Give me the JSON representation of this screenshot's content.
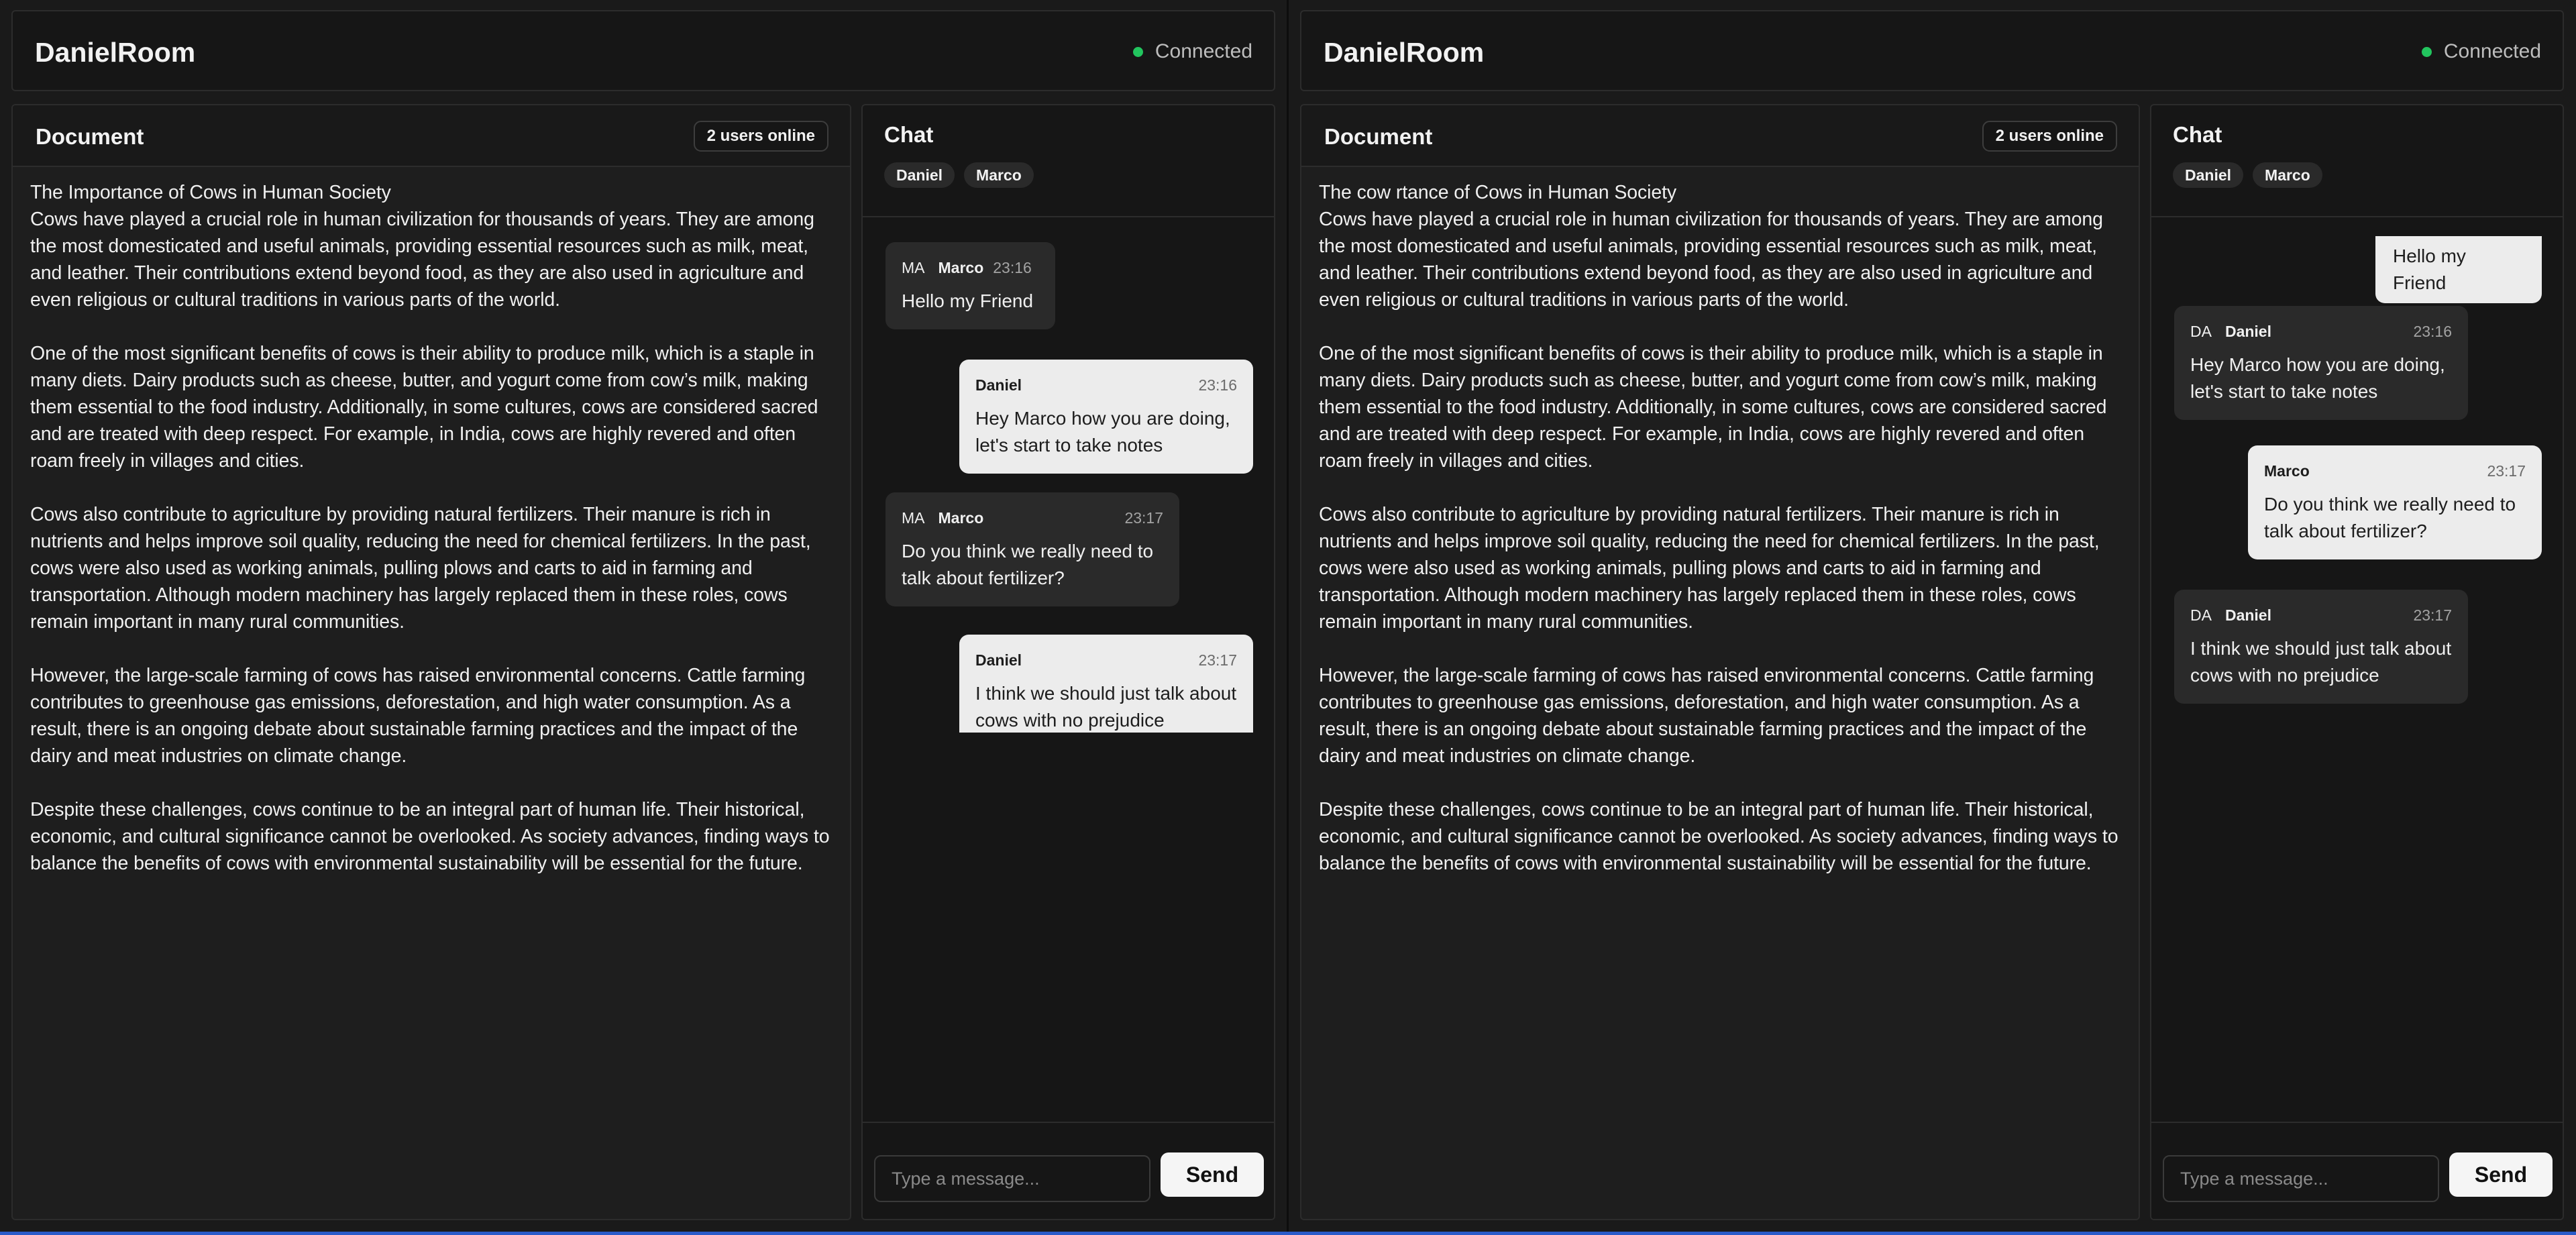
{
  "left": {
    "room_name": "DanielRoom",
    "status": "Connected",
    "document": {
      "title": "Document",
      "users_online": "2 users online",
      "body": "The Importance of Cows in Human Society\nCows have played a crucial role in human civilization for thousands of years. They are among the most domesticated and useful animals, providing essential resources such as milk, meat, and leather. Their contributions extend beyond food, as they are also used in agriculture and even religious or cultural traditions in various parts of the world.\n\nOne of the most significant benefits of cows is their ability to produce milk, which is a staple in many diets. Dairy products such as cheese, butter, and yogurt come from cow’s milk, making them essential to the food industry. Additionally, in some cultures, cows are considered sacred and are treated with deep respect. For example, in India, cows are highly revered and often roam freely in villages and cities.\n\nCows also contribute to agriculture by providing natural fertilizers. Their manure is rich in nutrients and helps improve soil quality, reducing the need for chemical fertilizers. In the past, cows were also used as working animals, pulling plows and carts to aid in farming and transportation. Although modern machinery has largely replaced them in these roles, cows remain important in many rural communities.\n\nHowever, the large-scale farming of cows has raised environmental concerns. Cattle farming contributes to greenhouse gas emissions, deforestation, and high water consumption. As a result, there is an ongoing debate about sustainable farming practices and the impact of the dairy and meat industries on climate change.\n\nDespite these challenges, cows continue to be an integral part of human life. Their historical, economic, and cultural significance cannot be overlooked. As society advances, finding ways to balance the benefits of cows with environmental sustainability will be essential for the future."
    },
    "chat": {
      "title": "Chat",
      "participants": [
        "Daniel",
        "Marco"
      ],
      "messages": [
        {
          "initials": "MA",
          "sender": "Marco",
          "time": "23:16",
          "text": "Hello my Friend"
        },
        {
          "initials": "",
          "sender": "Daniel",
          "time": "23:16",
          "text": "Hey Marco how you are doing, let's start to take notes"
        },
        {
          "initials": "MA",
          "sender": "Marco",
          "time": "23:17",
          "text": "Do you think we really need to talk about fertilizer?"
        },
        {
          "initials": "",
          "sender": "Daniel",
          "time": "23:17",
          "text": "I think we should just talk about cows with no prejudice"
        }
      ],
      "input_placeholder": "Type a message...",
      "send_label": "Send"
    }
  },
  "right": {
    "room_name": "DanielRoom",
    "status": "Connected",
    "document": {
      "title": "Document",
      "users_online": "2 users online",
      "body": "The cow rtance of Cows in Human Society\nCows have played a crucial role in human civilization for thousands of years. They are among the most domesticated and useful animals, providing essential resources such as milk, meat, and leather. Their contributions extend beyond food, as they are also used in agriculture and even religious or cultural traditions in various parts of the world.\n\nOne of the most significant benefits of cows is their ability to produce milk, which is a staple in many diets. Dairy products such as cheese, butter, and yogurt come from cow’s milk, making them essential to the food industry. Additionally, in some cultures, cows are considered sacred and are treated with deep respect. For example, in India, cows are highly revered and often roam freely in villages and cities.\n\nCows also contribute to agriculture by providing natural fertilizers. Their manure is rich in nutrients and helps improve soil quality, reducing the need for chemical fertilizers. In the past, cows were also used as working animals, pulling plows and carts to aid in farming and transportation. Although modern machinery has largely replaced them in these roles, cows remain important in many rural communities.\n\nHowever, the large-scale farming of cows has raised environmental concerns. Cattle farming contributes to greenhouse gas emissions, deforestation, and high water consumption. As a result, there is an ongoing debate about sustainable farming practices and the impact of the dairy and meat industries on climate change.\n\nDespite these challenges, cows continue to be an integral part of human life. Their historical, economic, and cultural significance cannot be overlooked. As society advances, finding ways to balance the benefits of cows with environmental sustainability will be essential for the future."
    },
    "chat": {
      "title": "Chat",
      "participants": [
        "Daniel",
        "Marco"
      ],
      "messages": [
        {
          "initials": "",
          "sender": "",
          "time": "",
          "text": "Hello my Friend"
        },
        {
          "initials": "DA",
          "sender": "Daniel",
          "time": "23:16",
          "text": "Hey Marco how you are doing, let's start to take notes"
        },
        {
          "initials": "",
          "sender": "Marco",
          "time": "23:17",
          "text": "Do you think we really need to talk about fertilizer?"
        },
        {
          "initials": "DA",
          "sender": "Daniel",
          "time": "23:17",
          "text": "I think we should just talk about cows with no prejudice"
        }
      ],
      "input_placeholder": "Type a message...",
      "send_label": "Send"
    }
  },
  "colors": {
    "connected_dot": "#22c55e",
    "own_bubble": "#ececec",
    "other_bubble": "#2a2a2a"
  }
}
